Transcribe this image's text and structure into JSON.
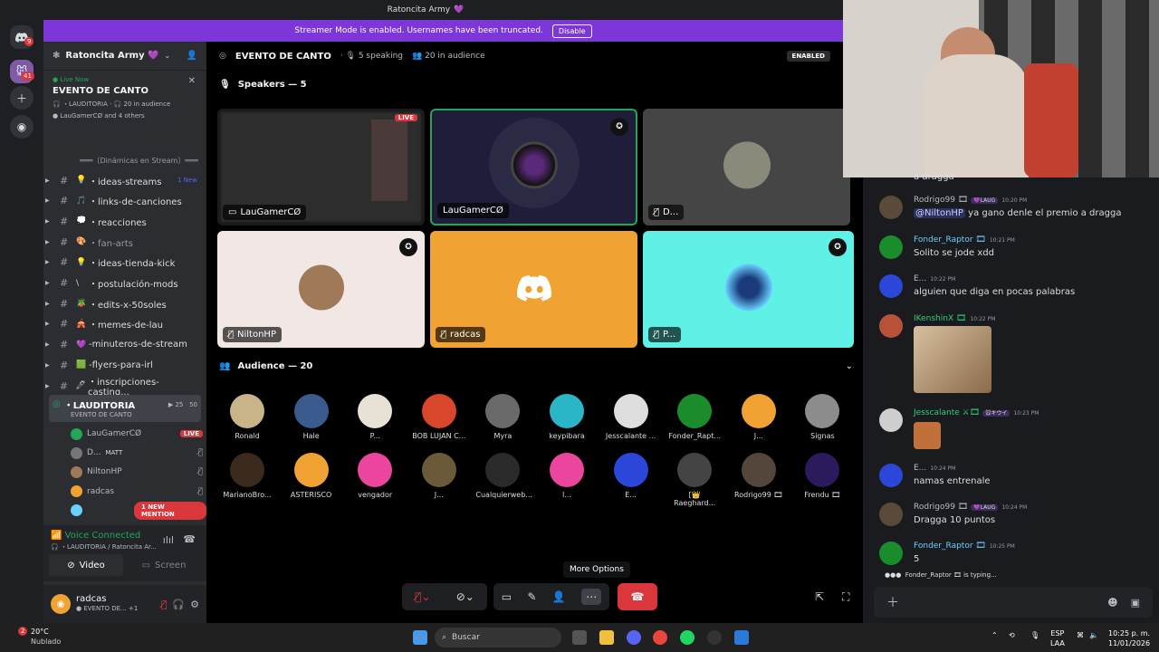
{
  "app": {
    "window_title": "Ratoncita Army",
    "title_emoji": "💜"
  },
  "rail": {
    "badge_top": "9",
    "badge_server": "41"
  },
  "banner": {
    "text": "Streamer Mode is enabled. Usernames have been truncated.",
    "disable_label": "Disable"
  },
  "sidebar": {
    "server_name": "Ratoncita Army 💜",
    "live_now": "Live Now",
    "event_title": "EVENTO DE CANTO",
    "event_channel": "・LAUDITORIA",
    "event_audience": "20 in audience",
    "event_people": "LauGamerCØ and 4 others",
    "category": "═══〔Dinámicas en Stream〕═══",
    "channels": [
      {
        "emoji": "💡",
        "label": "・ideas-streams",
        "badge": "1 New"
      },
      {
        "emoji": "🎵",
        "label": "・links-de-canciones",
        "badge": ""
      },
      {
        "emoji": "💭",
        "label": "・reacciones",
        "badge": ""
      },
      {
        "emoji": "🎨",
        "label": "・fan-arts",
        "badge": ""
      },
      {
        "emoji": "💡",
        "label": "・ideas-tienda-kick",
        "badge": ""
      },
      {
        "emoji": "\\",
        "label": "・postulación-mods",
        "badge": ""
      },
      {
        "emoji": "🪴",
        "label": "・edits-x-50soles",
        "badge": ""
      },
      {
        "emoji": "🎪",
        "label": "・memes-de-lau",
        "badge": ""
      },
      {
        "emoji": "💜",
        "label": "-minuteros-de-stream",
        "badge": ""
      },
      {
        "emoji": "🟩",
        "label": "-flyers-para-irl",
        "badge": ""
      },
      {
        "emoji": "🖊",
        "label": "・inscripciones-casting...",
        "badge": ""
      }
    ],
    "voice_channel": {
      "name": "・LAUDITORIA",
      "event": "EVENTO DE CANTO",
      "count_a": "25",
      "count_b": "50"
    },
    "voice_users": [
      {
        "name": "LauGamerCØ",
        "tag": "LIVE"
      },
      {
        "name": "D...",
        "tag": "MATT"
      },
      {
        "name": "NiltonHP",
        "tag": ""
      },
      {
        "name": "radcas",
        "tag": ""
      },
      {
        "name": "",
        "tag": ""
      }
    ],
    "new_mention": "1 NEW MENTION",
    "voice_connected": "Voice Connected",
    "voice_location": "・LAUDITORIA / Ratoncita Ar...",
    "video_label": "Video",
    "screen_label": "Screen",
    "user_name": "radcas",
    "user_status": "EVENTO DE...",
    "user_plus": "+1"
  },
  "stage": {
    "title": "EVENTO DE CANTO",
    "speaking": "5 speaking",
    "audience": "20 in audience",
    "enabled_label": "ENABLED",
    "speakers_label": "Speakers — 5",
    "audience_label": "Audience — 20",
    "tiles": [
      {
        "name": "LauGamerCØ",
        "live": "LIVE"
      },
      {
        "name": "LauGamerCØ"
      },
      {
        "name": "D..."
      },
      {
        "name": "NiltonHP"
      },
      {
        "name": "radcas"
      },
      {
        "name": "P..."
      }
    ],
    "audience_members": [
      {
        "name": "Ronald",
        "color": "#c9b48a"
      },
      {
        "name": "Hale",
        "color": "#3b5b8f"
      },
      {
        "name": "P...",
        "color": "#e8e2d6"
      },
      {
        "name": "BOB LUJAN C...",
        "color": "#d8462b"
      },
      {
        "name": "Myra",
        "color": "#6a6a6a"
      },
      {
        "name": "keypibara",
        "color": "#2bb6c8"
      },
      {
        "name": "Jesscalante ...",
        "color": "#dedede"
      },
      {
        "name": "Fonder_Rapt...",
        "color": "#1b8c2c"
      },
      {
        "name": "J...",
        "color": "#f0a232"
      },
      {
        "name": "Signas",
        "color": "#8c8c8c"
      },
      {
        "name": "MarianoBro...",
        "color": "#3a2a1e"
      },
      {
        "name": "ASTERISCO",
        "color": "#f0a232"
      },
      {
        "name": "vengador",
        "color": "#eb459e"
      },
      {
        "name": "J...",
        "color": "#6b5a3a"
      },
      {
        "name": "Cualquierweb...",
        "color": "#2a2a2a"
      },
      {
        "name": "I...",
        "color": "#eb459e"
      },
      {
        "name": "E...",
        "color": "#2b46d8"
      },
      {
        "name": "[👑 Raeghard...",
        "color": "#444"
      },
      {
        "name": "Rodrigo99 🎞",
        "color": "#54463a"
      },
      {
        "name": "Frendu 🎞",
        "color": "#2b1a5c"
      }
    ],
    "tooltip": "More Options"
  },
  "chat": {
    "partial_top": "a dragga",
    "messages": [
      {
        "name": "Rodrigo99 🎞",
        "tag": "💜LAUG",
        "time": "10:20 PM",
        "mention": "@NiltonHP",
        "text": " ya gano denle el premio a dragga",
        "color": "#5a4a3a",
        "name_color": "#b5bac1"
      },
      {
        "name": "Fonder_Raptor 🎞",
        "tag": "",
        "time": "10:21 PM",
        "mention": "",
        "text": "Solito se jode xdd",
        "color": "#1b8c2c",
        "name_color": "#6ad0ff"
      },
      {
        "name": "E...",
        "tag": "",
        "time": "10:22 PM",
        "mention": "",
        "text": "alguien que diga en pocas palabras",
        "color": "#2b46d8",
        "name_color": "#b5bac1"
      },
      {
        "name": "IKenshinX 🎞",
        "tag": "",
        "time": "10:22 PM",
        "mention": "",
        "text": "",
        "color": "#b8533a",
        "name_color": "#2bd07a"
      },
      {
        "name": "Jesscalante ⚔🎞",
        "tag": "🐭キウイ",
        "time": "10:23 PM",
        "mention": "",
        "text": "",
        "color": "#cfcfcf",
        "name_color": "#2bd07a"
      },
      {
        "name": "E...",
        "tag": "",
        "time": "10:24 PM",
        "mention": "",
        "text": "namas entrenale",
        "color": "#2b46d8",
        "name_color": "#b5bac1"
      },
      {
        "name": "Rodrigo99 🎞",
        "tag": "💜LAUG",
        "time": "10:24 PM",
        "mention": "",
        "text": "Dragga 10 puntos",
        "color": "#5a4a3a",
        "name_color": "#b5bac1"
      },
      {
        "name": "Fonder_Raptor 🎞",
        "tag": "",
        "time": "10:25 PM",
        "mention": "",
        "text": "5",
        "color": "#1b8c2c",
        "name_color": "#6ad0ff"
      }
    ],
    "typing": "Fonder_Raptor 🎞 is typing..."
  },
  "taskbar": {
    "temp": "20°C",
    "weather": "Nublado",
    "search_placeholder": "Buscar",
    "lang_a": "ESP",
    "lang_b": "LAA",
    "time": "10:25 p. m.",
    "date": "11/01/2026",
    "weather_badge": "2"
  }
}
